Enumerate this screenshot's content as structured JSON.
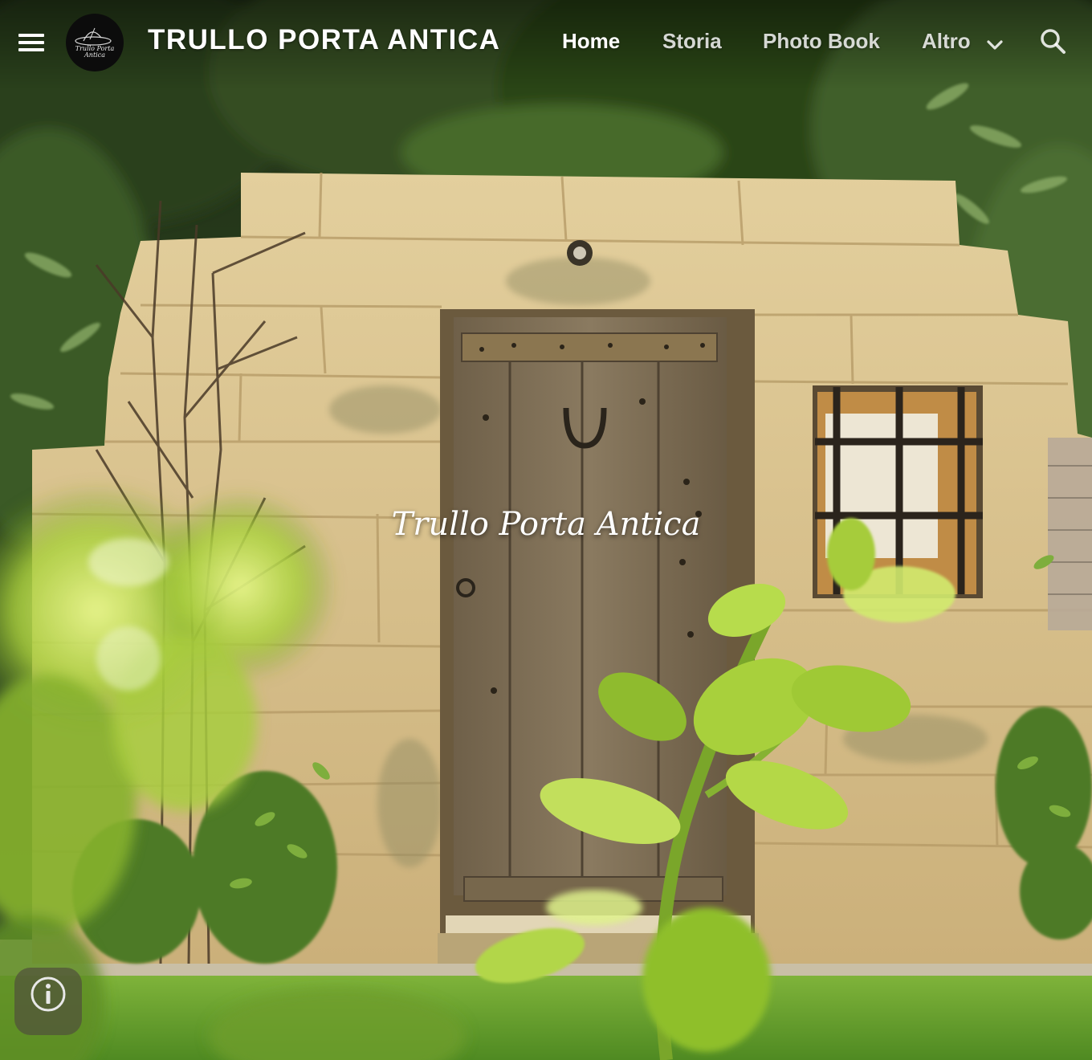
{
  "header": {
    "site_title": "TRULLO PORTA ANTICA",
    "logo_text_line1": "Trullo Porta",
    "logo_text_line2": "Antica",
    "nav": {
      "home": "Home",
      "storia": "Storia",
      "photo_book": "Photo Book",
      "altro": "Altro"
    },
    "active_nav": "home",
    "icons": {
      "menu": "menu-icon",
      "more": "chevron-down-icon",
      "search": "search-icon",
      "info": "info-icon"
    }
  },
  "hero": {
    "title": "Trullo Porta Antica"
  },
  "colors": {
    "stone": "#d6c08e",
    "door_wood": "#7a6a52",
    "foliage_dark": "#2f4a1e",
    "leaf_bright": "#b8d94a",
    "grass": "#5e9a2c",
    "text": "#ffffff"
  }
}
